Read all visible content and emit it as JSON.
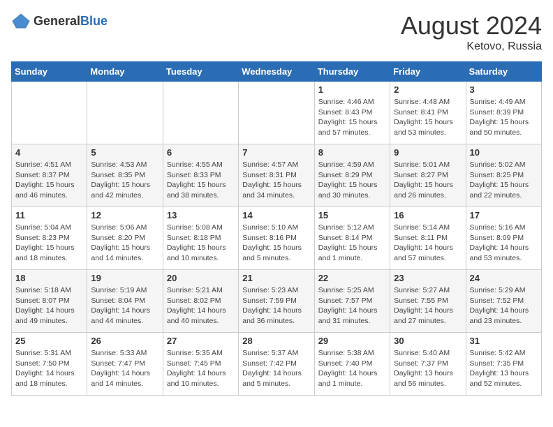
{
  "header": {
    "logo_general": "General",
    "logo_blue": "Blue",
    "main_title": "August 2024",
    "subtitle": "Ketovo, Russia"
  },
  "days_of_week": [
    "Sunday",
    "Monday",
    "Tuesday",
    "Wednesday",
    "Thursday",
    "Friday",
    "Saturday"
  ],
  "weeks": [
    {
      "days": [
        {
          "number": "",
          "info": ""
        },
        {
          "number": "",
          "info": ""
        },
        {
          "number": "",
          "info": ""
        },
        {
          "number": "",
          "info": ""
        },
        {
          "number": "1",
          "info": "Sunrise: 4:46 AM\nSunset: 8:43 PM\nDaylight: 15 hours\nand 57 minutes."
        },
        {
          "number": "2",
          "info": "Sunrise: 4:48 AM\nSunset: 8:41 PM\nDaylight: 15 hours\nand 53 minutes."
        },
        {
          "number": "3",
          "info": "Sunrise: 4:49 AM\nSunset: 8:39 PM\nDaylight: 15 hours\nand 50 minutes."
        }
      ]
    },
    {
      "days": [
        {
          "number": "4",
          "info": "Sunrise: 4:51 AM\nSunset: 8:37 PM\nDaylight: 15 hours\nand 46 minutes."
        },
        {
          "number": "5",
          "info": "Sunrise: 4:53 AM\nSunset: 8:35 PM\nDaylight: 15 hours\nand 42 minutes."
        },
        {
          "number": "6",
          "info": "Sunrise: 4:55 AM\nSunset: 8:33 PM\nDaylight: 15 hours\nand 38 minutes."
        },
        {
          "number": "7",
          "info": "Sunrise: 4:57 AM\nSunset: 8:31 PM\nDaylight: 15 hours\nand 34 minutes."
        },
        {
          "number": "8",
          "info": "Sunrise: 4:59 AM\nSunset: 8:29 PM\nDaylight: 15 hours\nand 30 minutes."
        },
        {
          "number": "9",
          "info": "Sunrise: 5:01 AM\nSunset: 8:27 PM\nDaylight: 15 hours\nand 26 minutes."
        },
        {
          "number": "10",
          "info": "Sunrise: 5:02 AM\nSunset: 8:25 PM\nDaylight: 15 hours\nand 22 minutes."
        }
      ]
    },
    {
      "days": [
        {
          "number": "11",
          "info": "Sunrise: 5:04 AM\nSunset: 8:23 PM\nDaylight: 15 hours\nand 18 minutes."
        },
        {
          "number": "12",
          "info": "Sunrise: 5:06 AM\nSunset: 8:20 PM\nDaylight: 15 hours\nand 14 minutes."
        },
        {
          "number": "13",
          "info": "Sunrise: 5:08 AM\nSunset: 8:18 PM\nDaylight: 15 hours\nand 10 minutes."
        },
        {
          "number": "14",
          "info": "Sunrise: 5:10 AM\nSunset: 8:16 PM\nDaylight: 15 hours\nand 5 minutes."
        },
        {
          "number": "15",
          "info": "Sunrise: 5:12 AM\nSunset: 8:14 PM\nDaylight: 15 hours\nand 1 minute."
        },
        {
          "number": "16",
          "info": "Sunrise: 5:14 AM\nSunset: 8:11 PM\nDaylight: 14 hours\nand 57 minutes."
        },
        {
          "number": "17",
          "info": "Sunrise: 5:16 AM\nSunset: 8:09 PM\nDaylight: 14 hours\nand 53 minutes."
        }
      ]
    },
    {
      "days": [
        {
          "number": "18",
          "info": "Sunrise: 5:18 AM\nSunset: 8:07 PM\nDaylight: 14 hours\nand 49 minutes."
        },
        {
          "number": "19",
          "info": "Sunrise: 5:19 AM\nSunset: 8:04 PM\nDaylight: 14 hours\nand 44 minutes."
        },
        {
          "number": "20",
          "info": "Sunrise: 5:21 AM\nSunset: 8:02 PM\nDaylight: 14 hours\nand 40 minutes."
        },
        {
          "number": "21",
          "info": "Sunrise: 5:23 AM\nSunset: 7:59 PM\nDaylight: 14 hours\nand 36 minutes."
        },
        {
          "number": "22",
          "info": "Sunrise: 5:25 AM\nSunset: 7:57 PM\nDaylight: 14 hours\nand 31 minutes."
        },
        {
          "number": "23",
          "info": "Sunrise: 5:27 AM\nSunset: 7:55 PM\nDaylight: 14 hours\nand 27 minutes."
        },
        {
          "number": "24",
          "info": "Sunrise: 5:29 AM\nSunset: 7:52 PM\nDaylight: 14 hours\nand 23 minutes."
        }
      ]
    },
    {
      "days": [
        {
          "number": "25",
          "info": "Sunrise: 5:31 AM\nSunset: 7:50 PM\nDaylight: 14 hours\nand 18 minutes."
        },
        {
          "number": "26",
          "info": "Sunrise: 5:33 AM\nSunset: 7:47 PM\nDaylight: 14 hours\nand 14 minutes."
        },
        {
          "number": "27",
          "info": "Sunrise: 5:35 AM\nSunset: 7:45 PM\nDaylight: 14 hours\nand 10 minutes."
        },
        {
          "number": "28",
          "info": "Sunrise: 5:37 AM\nSunset: 7:42 PM\nDaylight: 14 hours\nand 5 minutes."
        },
        {
          "number": "29",
          "info": "Sunrise: 5:38 AM\nSunset: 7:40 PM\nDaylight: 14 hours\nand 1 minute."
        },
        {
          "number": "30",
          "info": "Sunrise: 5:40 AM\nSunset: 7:37 PM\nDaylight: 13 hours\nand 56 minutes."
        },
        {
          "number": "31",
          "info": "Sunrise: 5:42 AM\nSunset: 7:35 PM\nDaylight: 13 hours\nand 52 minutes."
        }
      ]
    }
  ]
}
